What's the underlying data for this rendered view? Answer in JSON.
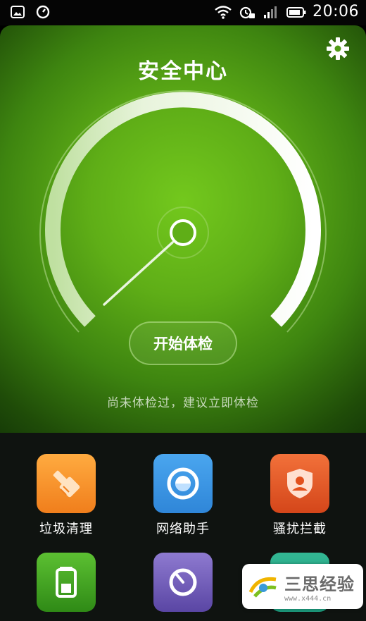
{
  "status_bar": {
    "time": "20:06",
    "left_icons": [
      "image-icon",
      "clock-icon"
    ],
    "right_icons": [
      "wifi-icon",
      "alarm-icon",
      "signal-icon",
      "battery-icon"
    ]
  },
  "header": {
    "title": "安全中心",
    "settings_icon": "gear-icon"
  },
  "gauge": {
    "status_text": "尚未体检过，建议立即体检",
    "button_label": "开始体检"
  },
  "features": [
    {
      "label": "垃圾清理",
      "icon": "broom-icon",
      "color": "#f07e1c"
    },
    {
      "label": "网络助手",
      "icon": "network-icon",
      "color": "#2f86d8"
    },
    {
      "label": "骚扰拦截",
      "icon": "shield-user-icon",
      "color": "#e2511d"
    },
    {
      "label": "",
      "icon": "battery-icon",
      "color": "#3da11f"
    },
    {
      "label": "",
      "icon": "cleaner-icon",
      "color": "#6a55b0"
    },
    {
      "label": "",
      "icon": "permission-icon",
      "color": "#1c9b7d"
    }
  ],
  "watermark": {
    "main": "三思经验",
    "sub": "www.x444.cn"
  },
  "colors": {
    "hero_green": "#5fae17",
    "grid_bg": "#0f1310"
  }
}
